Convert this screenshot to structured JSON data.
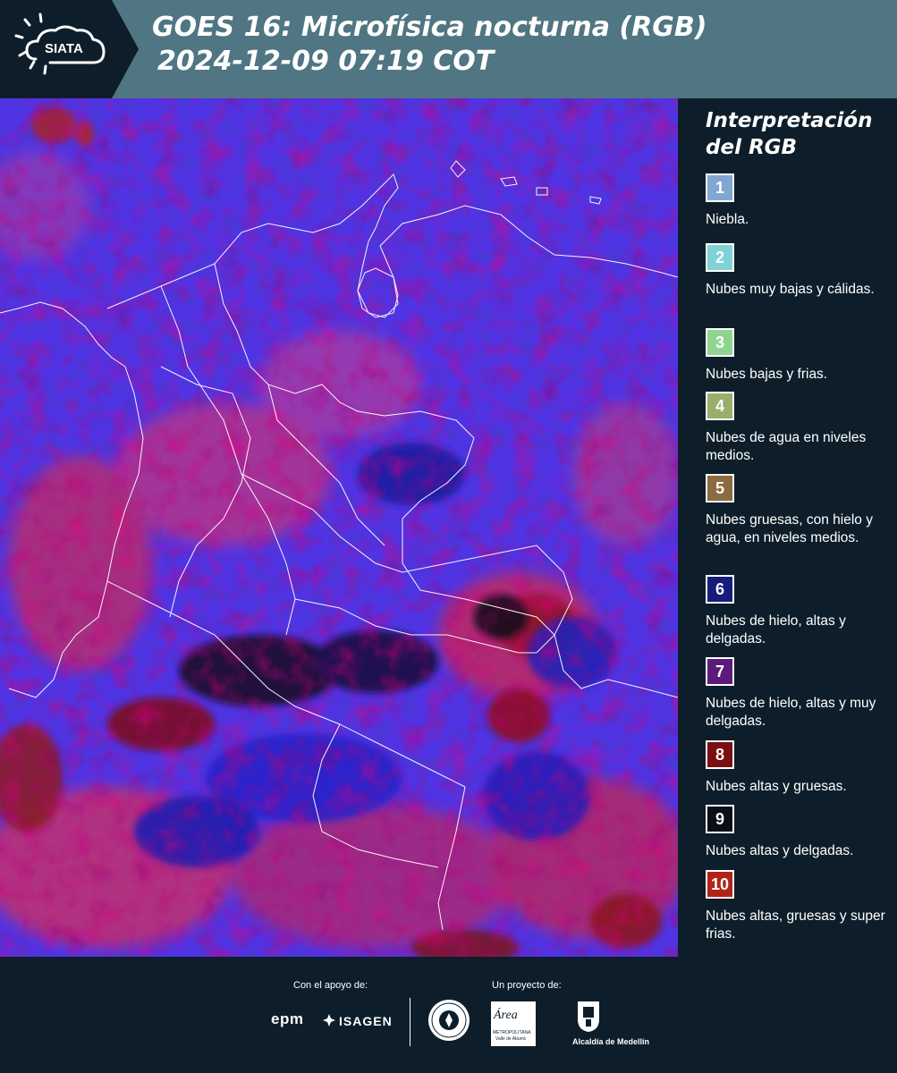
{
  "header": {
    "logo_text": "SIATA",
    "title_line1": "GOES 16: Microfísica nocturna (RGB)",
    "title_line2": "2024-12-09 07:19 COT",
    "background_color": "#4f7682"
  },
  "map": {
    "product": "Nighttime microphysics RGB satellite composite",
    "dominant_colors": [
      "#4a2ee0",
      "#c0307a",
      "#7a0c1a",
      "#1a1040"
    ]
  },
  "legend": {
    "title": "Interpretación del RGB",
    "items": [
      {
        "number": "1",
        "label": "Niebla.",
        "color": "#7fa7cf"
      },
      {
        "number": "2",
        "label": "Nubes muy bajas y cálidas.",
        "color": "#7fd3d6"
      },
      {
        "number": "3",
        "label": "Nubes bajas y frias.",
        "color": "#8fd58f"
      },
      {
        "number": "4",
        "label": "Nubes de agua en niveles medios.",
        "color": "#9aae6a"
      },
      {
        "number": "5",
        "label": "Nubes gruesas, con hielo y agua, en niveles medios.",
        "color": "#8a6c40"
      },
      {
        "number": "6",
        "label": "Nubes de hielo, altas y delgadas.",
        "color": "#141e7a"
      },
      {
        "number": "7",
        "label": "Nubes de hielo, altas y muy delgadas.",
        "color": "#5c1a7a"
      },
      {
        "number": "8",
        "label": "Nubes altas y gruesas.",
        "color": "#7a0e12"
      },
      {
        "number": "9",
        "label": "Nubes altas y delgadas.",
        "color": "#0a0e18"
      },
      {
        "number": "10",
        "label": "Nubes altas, gruesas y super frias.",
        "color": "#b02418"
      }
    ]
  },
  "footer": {
    "support_label": "Con el apoyo de:",
    "project_label": "Un proyecto de:",
    "sponsor1": "epm",
    "sponsor2": "ISAGEN",
    "partner_area_name": "Área",
    "partner_area_sub1": "METROPOLITANA",
    "partner_area_sub2": "Valle de Aburrá",
    "partner_alcaldia": "Alcaldía de Medellín"
  }
}
